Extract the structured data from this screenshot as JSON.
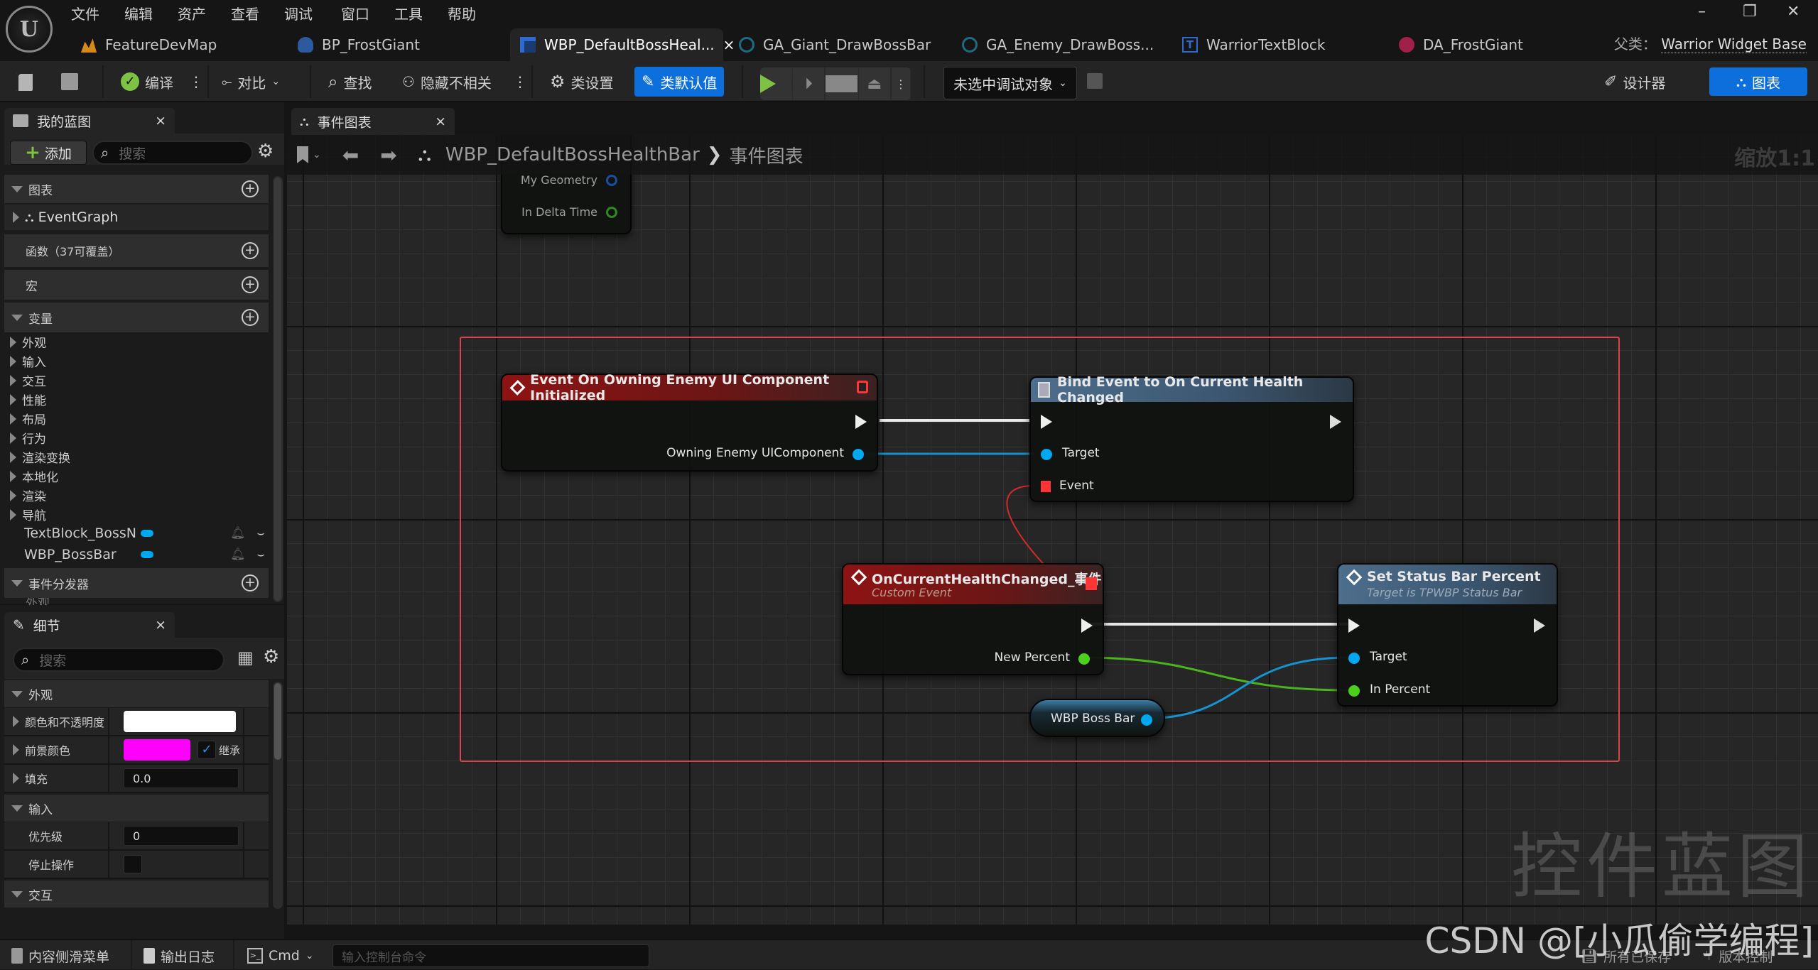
{
  "menu": [
    "文件",
    "编辑",
    "资产",
    "查看",
    "调试",
    "窗口",
    "工具",
    "帮助"
  ],
  "window_controls": {
    "minimize": "–",
    "restore": "❐",
    "close": "✕"
  },
  "doc_tabs": [
    {
      "label": "FeatureDevMap",
      "icon": "level-icon",
      "color": "#d68a1c"
    },
    {
      "label": "BP_FrostGiant",
      "icon": "character-blueprint-icon",
      "color": "#2d5a9e"
    },
    {
      "label": "WBP_DefaultBossHeal...",
      "icon": "widget-blueprint-icon",
      "color": "#2e6ad0",
      "active": true,
      "close": "×"
    },
    {
      "label": "GA_Giant_DrawBossBar",
      "icon": "gameplay-ability-icon",
      "color": "#1e6a80"
    },
    {
      "label": "GA_Enemy_DrawBoss...",
      "icon": "gameplay-ability-icon",
      "color": "#1e6a80"
    },
    {
      "label": "WarriorTextBlock",
      "icon": "text-block-class-icon",
      "color": "#2e6ad0"
    },
    {
      "label": "DA_FrostGiant",
      "icon": "data-asset-icon",
      "color": "#a0204a"
    }
  ],
  "parent_class": {
    "label": "父类：",
    "value": "Warrior Widget Base"
  },
  "toolbar": {
    "compile": "编译",
    "diff": "对比",
    "find": "查找",
    "hide_unrelated": "隐藏不相关",
    "class_settings": "类设置",
    "class_defaults": "类默认值",
    "debug_object": "未选中调试对象",
    "designer": "设计器",
    "graph": "图表",
    "accent": "#0d6fdc",
    "play_color": "#7dc242"
  },
  "my_blueprint": {
    "title": "我的蓝图",
    "add": "添加",
    "search_placeholder": "搜索",
    "sections": {
      "graphs": "图表",
      "event_graph": "EventGraph",
      "functions": "函数（37可覆盖）",
      "macros": "宏",
      "variables": "变量",
      "event_dispatchers": "事件分发器",
      "dispatcher_sub": "外观"
    },
    "variable_categories": [
      "外观",
      "输入",
      "交互",
      "性能",
      "布局",
      "行为",
      "渲染变换",
      "本地化",
      "渲染",
      "导航"
    ],
    "variables": [
      {
        "name": "TextBlock_BossN",
        "type_color": "#00a8f0"
      },
      {
        "name": "WBP_BossBar",
        "type_color": "#00a8f0"
      }
    ]
  },
  "details": {
    "title": "细节",
    "search_placeholder": "搜索",
    "appearance": "外观",
    "rows_appearance": [
      {
        "label": "颜色和不透明度",
        "color": "#ffffff"
      },
      {
        "label": "前景颜色",
        "color": "#ff00ff",
        "inherit_label": "继承",
        "inherit_checked": true
      },
      {
        "label": "填充",
        "value": "0.0"
      }
    ],
    "input": "输入",
    "rows_input": [
      {
        "label": "优先级",
        "value": "0"
      },
      {
        "label": "停止操作",
        "checked": false
      }
    ],
    "interaction": "交互"
  },
  "graph": {
    "tab": "事件图表",
    "breadcrumb_root": "WBP_DefaultBossHealthBar",
    "breadcrumb_sep": "❯",
    "breadcrumb_leaf": "事件图表",
    "zoom": "缩放1:1",
    "watermark": "控件蓝图",
    "tick_node": {
      "pins": [
        "My Geometry",
        "In Delta Time"
      ]
    },
    "nodes": {
      "event_init": {
        "title": "Event On Owning Enemy UI Component Initialized",
        "out_pin": "Owning Enemy UIComponent"
      },
      "bind": {
        "title": "Bind Event to On Current Health Changed",
        "pins": [
          "Target",
          "Event"
        ]
      },
      "custom_event": {
        "title": "OnCurrentHealthChanged_事件",
        "subtitle": "Custom Event",
        "out_pin": "New Percent"
      },
      "set_percent": {
        "title": "Set Status Bar Percent",
        "subtitle": "Target is TPWBP Status Bar",
        "pins": [
          "Target",
          "In Percent"
        ]
      },
      "getter": {
        "label": "WBP Boss Bar"
      }
    },
    "colors": {
      "object_pin": "#00a8f0",
      "float_pin": "#4bd11c",
      "delegate_pin": "#ff3535",
      "comment_border": "#d9434f"
    }
  },
  "statusbar": {
    "content_drawer": "内容侧滑菜单",
    "output_log": "输出日志",
    "cmd": "Cmd",
    "console_placeholder": "输入控制台命令",
    "saved": "所有已保存",
    "source_control": "版本控制"
  },
  "watermark_credit": "CSDN @[小瓜偷学编程]"
}
